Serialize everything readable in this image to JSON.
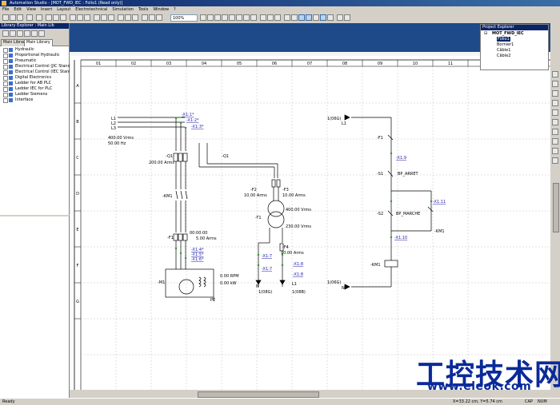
{
  "window": {
    "title": "Automation Studio - [MOT_FWD_IEC : Folio1 (Read only)]"
  },
  "menu": [
    "File",
    "Edit",
    "View",
    "Insert",
    "Layout",
    "Electrotechnical",
    "Simulation",
    "Tools",
    "Window",
    "?"
  ],
  "toolbar": {
    "zoom": "100%"
  },
  "library_explorer": {
    "title": "Library Explorer : Main Lib",
    "tabs": [
      "Main Library",
      "Main Library"
    ],
    "items": [
      "Hydraulic",
      "Proportional Hydraulic",
      "Pneumatic",
      "Electrical Control (JIC Standa",
      "Electrical Control (IEC Standa",
      "Digital Electronics",
      "Ladder for AB PLC",
      "Ladder IEC for PLC",
      "Ladder Siemens",
      "Interface"
    ]
  },
  "project_explorer": {
    "title": "Project Explorer",
    "root": "MOT_FWD_IEC",
    "items": [
      "Folio1",
      "Bornier1",
      "Câble1",
      "Câble2"
    ]
  },
  "status": {
    "left": "Ready",
    "coords": "X=33.22 cm, Y=5.74 cm",
    "caps": "CAP",
    "num": "NUM"
  },
  "diagram": {
    "columns": [
      "01",
      "02",
      "03",
      "04",
      "05",
      "06",
      "07",
      "08",
      "09",
      "10",
      "11"
    ],
    "rows": [
      "A",
      "B",
      "C",
      "D",
      "E",
      "F",
      "G"
    ],
    "labels": {
      "L1": "L1",
      "L2": "L2",
      "L3": "L3",
      "supply_v": "400.00 Vrms",
      "supply_f": "50.00 Hz",
      "x1_1": "-X1:1*",
      "x1_2": "-X1:2*",
      "x1_3": "-X1:3*",
      "q1": "-Q1",
      "q1_amps": "200.00 Arms",
      "q1b": "-Q1",
      "km1": "-KM1",
      "f1": "-F1",
      "f1_time": "00:00:00",
      "f1_amps": "5.00 Arms",
      "x1_4": "-X1:4*",
      "x1_5": "-X1:5*",
      "x1_6": "-X1:6*",
      "m1": "-M1",
      "rpm": "0.00 RPM",
      "kw": "0.00 kW",
      "pe": "PE",
      "f2": "-F2",
      "f2_amps": "10.00 Arms",
      "f3": "-F3",
      "f3_amps": "10.00 Arms",
      "t1": "-T1",
      "t1_in": "400.00 Vrms",
      "t1_out": "230.00 Vrms",
      "f4": "-F4",
      "f4_amps": "10.00 Arms",
      "x1_7": "-X1:7",
      "x1_7b": "-X1:7",
      "x1_8": "-X1:8",
      "x1_8b": "-X1:8",
      "n": "N",
      "n_ref": "1(08G)",
      "l1": "L1",
      "l1_ref": "1(08B)",
      "ref_top": "1(06G)",
      "ref_top_l1": "L1",
      "cf1": "-F1",
      "x1_9": "-X1:9",
      "s1": "-S1",
      "bp_arret": "BP_ARRET",
      "x1_11": "-X1:11",
      "s2": "-S2",
      "bp_marche": "BP_MARCHE",
      "x1_10": "-X1:10",
      "km1b": "-KM1",
      "km1c": "-KM1",
      "ref_bot": "1(06G)",
      "ref_bot_n": "N"
    }
  },
  "watermark": {
    "line1": "工控技术网",
    "line2": "www.eleok.com"
  }
}
